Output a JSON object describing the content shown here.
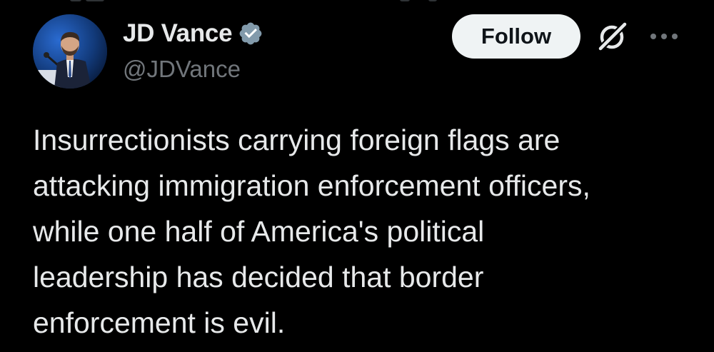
{
  "author": {
    "display_name": "JD Vance",
    "handle": "@JDVance",
    "verified": true,
    "verified_badge_icon": "verified-badge-icon",
    "avatar_icon": "profile-photo"
  },
  "actions": {
    "follow_label": "Follow",
    "grok_icon": "grok-icon",
    "more_icon": "more-options-icon"
  },
  "tweet": {
    "lines": [
      "Insurrectionists carrying foreign flags are",
      "attacking immigration enforcement officers,",
      "while one half of America's political",
      "leadership has decided that border",
      "enforcement is evil."
    ]
  },
  "colors": {
    "background": "#000000",
    "primary_text": "#e7e9ea",
    "secondary_text": "#71767b",
    "follow_button_bg": "#eff3f4",
    "follow_button_text": "#0f1419",
    "verified_badge": "#829aab"
  }
}
